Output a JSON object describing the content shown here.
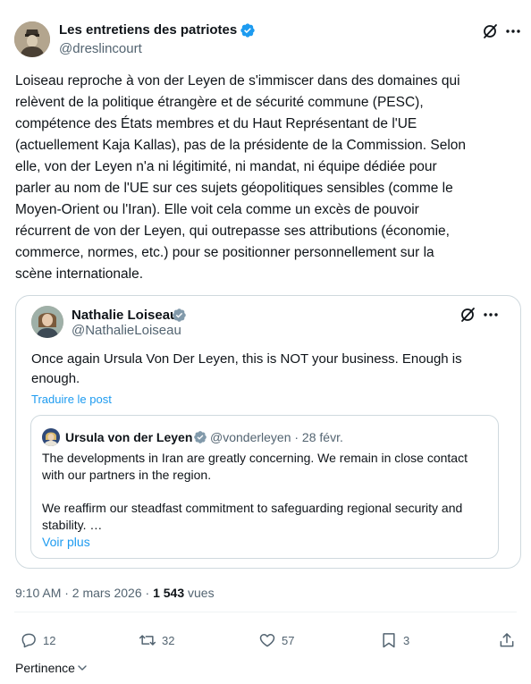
{
  "author": {
    "name": "Les entretiens des patriotes",
    "handle": "@dreslincourt"
  },
  "post": {
    "text": "Loiseau reproche à von der Leyen de s'immiscer dans des domaines qui\nrelèvent de la politique étrangère et de sécurité commune (PESC),\ncompétence des États membres et du Haut Représentant de l'UE\n(actuellement Kaja Kallas), pas de la présidente de la Commission. Selon\nelle, von der Leyen n'a ni légitimité, ni mandat, ni équipe dédiée pour\nparler au nom de l'UE sur ces sujets géopolitiques sensibles (comme le\nMoyen-Orient ou l'Iran). Elle voit cela comme un excès de pouvoir\nrécurrent de von der Leyen, qui outrepasse ses attributions (économie,\ncommerce, normes, etc.) pour se positionner personnellement sur la\nscène internationale."
  },
  "quote": {
    "name": "Nathalie Loiseau",
    "handle": "@NathalieLoiseau",
    "text": "Once again Ursula Von Der Leyen, this is NOT your business. Enough is\nenough.",
    "translate_label": "Traduire le post"
  },
  "nested_quote": {
    "name": "Ursula von der Leyen",
    "handle_date": "@vonderleyen · 28 févr.",
    "text1": "The developments in Iran are greatly concerning. We remain in close contact\nwith our partners in the region.",
    "text2": "We reaffirm our steadfast commitment to safeguarding regional security and\nstability. …",
    "more_label": "Voir plus"
  },
  "meta": {
    "time_date": "9:10 AM · 2 mars 2026 · ",
    "views_count": "1 543",
    "views_label": " vues"
  },
  "actions": {
    "replies": "12",
    "reposts": "32",
    "likes": "57",
    "bookmarks": "3"
  },
  "sort": {
    "label": "Pertinence"
  },
  "colors": {
    "accent": "#1d9bf0",
    "secondary_text": "#536471",
    "border": "#cfd9de"
  }
}
